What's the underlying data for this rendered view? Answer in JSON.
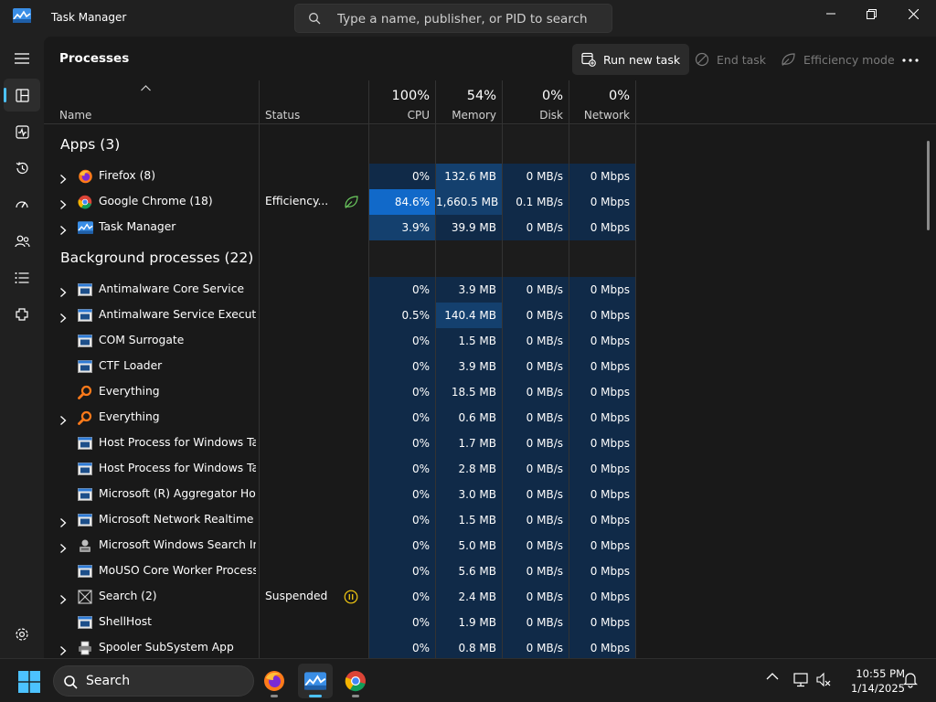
{
  "window": {
    "title": "Task Manager",
    "search_placeholder": "Type a name, publisher, or PID to search"
  },
  "nav": {
    "items": [
      {
        "icon": "hamburger-menu-icon"
      },
      {
        "icon": "processes-icon",
        "active": true
      },
      {
        "icon": "performance-icon"
      },
      {
        "icon": "app-history-icon"
      },
      {
        "icon": "startup-apps-icon"
      },
      {
        "icon": "users-icon"
      },
      {
        "icon": "details-icon"
      },
      {
        "icon": "services-icon"
      },
      {
        "icon": "settings-icon"
      }
    ]
  },
  "toolbar": {
    "page_title": "Processes",
    "run_new_task": "Run new task",
    "end_task": "End task",
    "efficiency_mode": "Efficiency mode"
  },
  "columns": {
    "name": "Name",
    "status": "Status",
    "cpu_pct": "100%",
    "cpu": "CPU",
    "memory_pct": "54%",
    "memory": "Memory",
    "disk_pct": "0%",
    "disk": "Disk",
    "network_pct": "0%",
    "network": "Network"
  },
  "groups": {
    "apps": "Apps (3)",
    "background": "Background processes (22)"
  },
  "apps": [
    {
      "name": "Firefox (8)",
      "icon": "firefox",
      "expandable": true,
      "status": "",
      "status_icon": "",
      "cpu": "0%",
      "memory": "132.6 MB",
      "disk": "0 MB/s",
      "network": "0 Mbps",
      "cpu_level": 1,
      "mem_level": 2
    },
    {
      "name": "Google Chrome (18)",
      "icon": "chrome",
      "expandable": true,
      "status": "Efficiency...",
      "status_icon": "leaf",
      "cpu": "84.6%",
      "memory": "1,660.5 MB",
      "disk": "0.1 MB/s",
      "network": "0 Mbps",
      "cpu_level": 4,
      "mem_level": 2
    },
    {
      "name": "Task Manager",
      "icon": "taskmgr",
      "expandable": true,
      "status": "",
      "status_icon": "",
      "cpu": "3.9%",
      "memory": "39.9 MB",
      "disk": "0 MB/s",
      "network": "0 Mbps",
      "cpu_level": 2,
      "mem_level": 1
    }
  ],
  "background": [
    {
      "name": "Antimalware Core Service",
      "icon": "window",
      "expandable": true,
      "status": "",
      "status_icon": "",
      "cpu": "0%",
      "memory": "3.9 MB",
      "disk": "0 MB/s",
      "network": "0 Mbps",
      "cpu_level": 1,
      "mem_level": 1
    },
    {
      "name": "Antimalware Service Executable",
      "icon": "window",
      "expandable": true,
      "status": "",
      "status_icon": "",
      "cpu": "0.5%",
      "memory": "140.4 MB",
      "disk": "0 MB/s",
      "network": "0 Mbps",
      "cpu_level": 1,
      "mem_level": 2
    },
    {
      "name": "COM Surrogate",
      "icon": "window",
      "expandable": false,
      "status": "",
      "status_icon": "",
      "cpu": "0%",
      "memory": "1.5 MB",
      "disk": "0 MB/s",
      "network": "0 Mbps",
      "cpu_level": 1,
      "mem_level": 1
    },
    {
      "name": "CTF Loader",
      "icon": "window",
      "expandable": false,
      "status": "",
      "status_icon": "",
      "cpu": "0%",
      "memory": "3.9 MB",
      "disk": "0 MB/s",
      "network": "0 Mbps",
      "cpu_level": 1,
      "mem_level": 1
    },
    {
      "name": "Everything",
      "icon": "everything",
      "expandable": false,
      "status": "",
      "status_icon": "",
      "cpu": "0%",
      "memory": "18.5 MB",
      "disk": "0 MB/s",
      "network": "0 Mbps",
      "cpu_level": 1,
      "mem_level": 1
    },
    {
      "name": "Everything",
      "icon": "everything",
      "expandable": true,
      "status": "",
      "status_icon": "",
      "cpu": "0%",
      "memory": "0.6 MB",
      "disk": "0 MB/s",
      "network": "0 Mbps",
      "cpu_level": 1,
      "mem_level": 1
    },
    {
      "name": "Host Process for Windows Tasks",
      "icon": "window",
      "expandable": false,
      "status": "",
      "status_icon": "",
      "cpu": "0%",
      "memory": "1.7 MB",
      "disk": "0 MB/s",
      "network": "0 Mbps",
      "cpu_level": 1,
      "mem_level": 1
    },
    {
      "name": "Host Process for Windows Tasks",
      "icon": "window",
      "expandable": false,
      "status": "",
      "status_icon": "",
      "cpu": "0%",
      "memory": "2.8 MB",
      "disk": "0 MB/s",
      "network": "0 Mbps",
      "cpu_level": 1,
      "mem_level": 1
    },
    {
      "name": "Microsoft (R) Aggregator Host",
      "icon": "window",
      "expandable": false,
      "status": "",
      "status_icon": "",
      "cpu": "0%",
      "memory": "3.0 MB",
      "disk": "0 MB/s",
      "network": "0 Mbps",
      "cpu_level": 1,
      "mem_level": 1
    },
    {
      "name": "Microsoft Network Realtime I...",
      "icon": "window",
      "expandable": true,
      "status": "",
      "status_icon": "",
      "cpu": "0%",
      "memory": "1.5 MB",
      "disk": "0 MB/s",
      "network": "0 Mbps",
      "cpu_level": 1,
      "mem_level": 1
    },
    {
      "name": "Microsoft Windows Search In...",
      "icon": "search-indexer",
      "expandable": true,
      "status": "",
      "status_icon": "",
      "cpu": "0%",
      "memory": "5.0 MB",
      "disk": "0 MB/s",
      "network": "0 Mbps",
      "cpu_level": 1,
      "mem_level": 1
    },
    {
      "name": "MoUSO Core Worker Process",
      "icon": "window",
      "expandable": false,
      "status": "",
      "status_icon": "",
      "cpu": "0%",
      "memory": "5.6 MB",
      "disk": "0 MB/s",
      "network": "0 Mbps",
      "cpu_level": 1,
      "mem_level": 1
    },
    {
      "name": "Search (2)",
      "icon": "search-x",
      "expandable": true,
      "status": "Suspended",
      "status_icon": "pause",
      "cpu": "0%",
      "memory": "2.4 MB",
      "disk": "0 MB/s",
      "network": "0 Mbps",
      "cpu_level": 1,
      "mem_level": 1
    },
    {
      "name": "ShellHost",
      "icon": "window",
      "expandable": false,
      "status": "",
      "status_icon": "",
      "cpu": "0%",
      "memory": "1.9 MB",
      "disk": "0 MB/s",
      "network": "0 Mbps",
      "cpu_level": 1,
      "mem_level": 1
    },
    {
      "name": "Spooler SubSystem App",
      "icon": "printer",
      "expandable": true,
      "status": "",
      "status_icon": "",
      "cpu": "0%",
      "memory": "0.8 MB",
      "disk": "0 MB/s",
      "network": "0 Mbps",
      "cpu_level": 1,
      "mem_level": 1
    }
  ],
  "heat_colors": {
    "1": "#102a48",
    "2": "#14406e",
    "4": "#1169c9"
  },
  "taskbar": {
    "search_label": "Search",
    "apps": [
      {
        "icon": "firefox-icon",
        "active": false
      },
      {
        "icon": "task-manager-icon",
        "active": true
      },
      {
        "icon": "chrome-icon",
        "active": false
      }
    ],
    "time": "10:55 PM",
    "date": "1/14/2025"
  }
}
